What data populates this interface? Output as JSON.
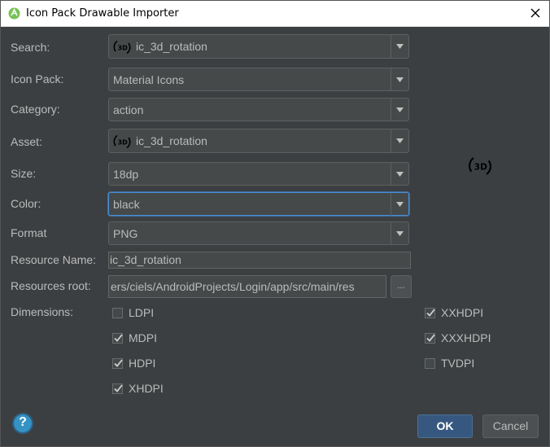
{
  "window": {
    "title": "Icon Pack Drawable Importer",
    "close_icon": "close-icon"
  },
  "form": {
    "search": {
      "label": "Search:",
      "value": "ic_3d_rotation",
      "icon": "3d-rotation-icon"
    },
    "icon_pack": {
      "label": "Icon Pack:",
      "value": "Material Icons"
    },
    "category": {
      "label": "Category:",
      "value": "action"
    },
    "asset": {
      "label": "Asset:",
      "value": "ic_3d_rotation",
      "icon": "3d-rotation-icon"
    },
    "size": {
      "label": "Size:",
      "value": "18dp"
    },
    "color": {
      "label": "Color:",
      "value": "black"
    },
    "format": {
      "label": "Format",
      "value": "PNG"
    },
    "resource_name": {
      "label": "Resource Name:",
      "value": "ic_3d_rotation"
    },
    "resources_root": {
      "label": "Resources root:",
      "value": "ers/ciels/AndroidProjects/Login/app/src/main/res",
      "browse_label": "..."
    },
    "dimensions": {
      "label": "Dimensions:",
      "items": [
        {
          "label": "LDPI",
          "checked": false
        },
        {
          "label": "MDPI",
          "checked": true
        },
        {
          "label": "HDPI",
          "checked": true
        },
        {
          "label": "XHDPI",
          "checked": true
        },
        {
          "label": "XXHDPI",
          "checked": true
        },
        {
          "label": "XXXHDPI",
          "checked": true
        },
        {
          "label": "TVDPI",
          "checked": false
        }
      ]
    }
  },
  "preview": {
    "icon": "3d-rotation-icon"
  },
  "footer": {
    "help_label": "?",
    "ok_label": "OK",
    "cancel_label": "Cancel"
  },
  "colors": {
    "background": "#3c3f41",
    "field": "#45494a",
    "focus": "#4a8fd6",
    "ok_button": "#365880",
    "text": "#bbbbbb",
    "help": "#3592c4"
  }
}
